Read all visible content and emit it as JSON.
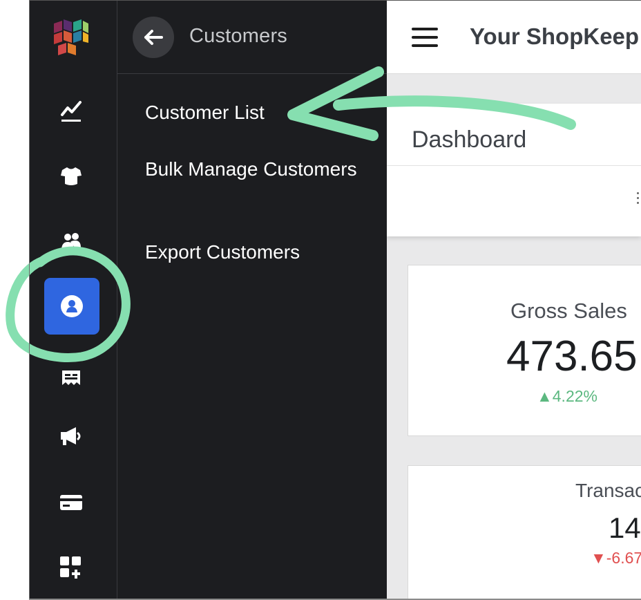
{
  "submenu": {
    "title": "Customers",
    "items": [
      {
        "label": "Customer List"
      },
      {
        "label": "Bulk Manage Customers"
      },
      {
        "label": "Export Customers"
      }
    ]
  },
  "topbar": {
    "store_title": "Your ShopKeep"
  },
  "dashboard": {
    "title": "Dashboard"
  },
  "stats": {
    "gross_sales": {
      "label": "Gross Sales",
      "value": "473.65",
      "change": "▲4.22%"
    },
    "transactions": {
      "label": "Transact",
      "value": "14",
      "change": "▼-6.67"
    }
  },
  "rail": {
    "icons": [
      "sales-chart-icon",
      "items-shirt-icon",
      "employees-icon",
      "customer-icon",
      "receipt-icon",
      "marketing-megaphone-icon",
      "payments-card-icon",
      "add-apps-icon"
    ],
    "active": "customer-icon"
  },
  "colors": {
    "sidebar_bg": "#1c1d20",
    "active_tile": "#2f66e0",
    "annotation": "#86dfb0",
    "positive": "#5cb880",
    "negative": "#e05050"
  }
}
